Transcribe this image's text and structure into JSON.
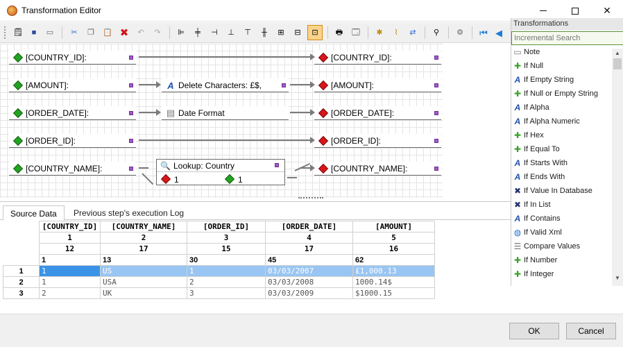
{
  "window": {
    "title": "Transformation Editor"
  },
  "toolbar": {
    "icons": [
      "properties-icon",
      "save-icon",
      "reload-icon",
      "cut-icon",
      "copy-icon",
      "paste-icon",
      "delete-icon",
      "undo-icon",
      "redo-icon",
      "align-left-icon",
      "align-center-icon",
      "align-right-icon",
      "align-bottom-icon",
      "align-top-icon",
      "align-middle-icon",
      "size-height-icon",
      "size-width-icon",
      "size-both-icon",
      "print-icon",
      "print-preview-icon",
      "new-node-icon",
      "clean-icon",
      "connect-icon",
      "find-icon",
      "settings-icon",
      "first-icon",
      "prev-icon"
    ]
  },
  "canvas": {
    "source_fields": [
      "[COUNTRY_ID]:",
      "[AMOUNT]:",
      "[ORDER_DATE]:",
      "[ORDER_ID]:",
      "[COUNTRY_NAME]:"
    ],
    "target_fields": [
      "[COUNTRY_ID]:",
      "[AMOUNT]:",
      "[ORDER_DATE]:",
      "[ORDER_ID]:",
      "[COUNTRY_NAME]:"
    ],
    "transforms": {
      "delete_chars": "Delete Characters: £$,",
      "date_format": "Date Format",
      "lookup_title": "Lookup: Country",
      "lookup_in": "1",
      "lookup_out": "1"
    }
  },
  "transformations": {
    "header": "Transformations",
    "search_placeholder": "Incremental Search",
    "items": [
      {
        "label": "Note",
        "icon": "note-icon"
      },
      {
        "label": "If Null",
        "icon": "puzzle-icon"
      },
      {
        "label": "If Empty String",
        "icon": "function-icon"
      },
      {
        "label": "If Null or Empty String",
        "icon": "puzzle-icon"
      },
      {
        "label": "If Alpha",
        "icon": "function-icon"
      },
      {
        "label": "If Alpha Numeric",
        "icon": "function-icon"
      },
      {
        "label": "If Hex",
        "icon": "puzzle-icon"
      },
      {
        "label": "If Equal To",
        "icon": "puzzle-icon"
      },
      {
        "label": "If Starts With",
        "icon": "function-icon"
      },
      {
        "label": "If Ends With",
        "icon": "function-icon"
      },
      {
        "label": "If Value In Database",
        "icon": "database-icon"
      },
      {
        "label": "If In List",
        "icon": "database-icon"
      },
      {
        "label": "If Contains",
        "icon": "function-icon"
      },
      {
        "label": "If Valid Xml",
        "icon": "globe-icon"
      },
      {
        "label": "Compare Values",
        "icon": "compare-icon"
      },
      {
        "label": "If Number",
        "icon": "puzzle-icon"
      },
      {
        "label": "If Integer",
        "icon": "puzzle-icon"
      }
    ]
  },
  "tabs": {
    "source": "Source Data",
    "log": "Previous step's execution Log"
  },
  "grid": {
    "columns": [
      "[COUNTRY_ID]",
      "[COUNTRY_NAME]",
      "[ORDER_ID]",
      "[ORDER_DATE]",
      "[AMOUNT]"
    ],
    "positions": [
      "1",
      "2",
      "3",
      "4",
      "5"
    ],
    "widths": [
      "12",
      "17",
      "15",
      "17",
      "16"
    ],
    "starts": [
      "1",
      "13",
      "30",
      "45",
      "62"
    ],
    "rows": [
      {
        "num": "1",
        "cells": [
          "1",
          "US",
          "1",
          "03/03/2007",
          "£1,000.13"
        ]
      },
      {
        "num": "2",
        "cells": [
          "1",
          "USA",
          "2",
          "03/03/2008",
          "1000.14$"
        ]
      },
      {
        "num": "3",
        "cells": [
          "2",
          "UK",
          "3",
          "03/03/2009",
          "$1000.15"
        ]
      }
    ]
  },
  "buttons": {
    "ok": "OK",
    "cancel": "Cancel"
  }
}
